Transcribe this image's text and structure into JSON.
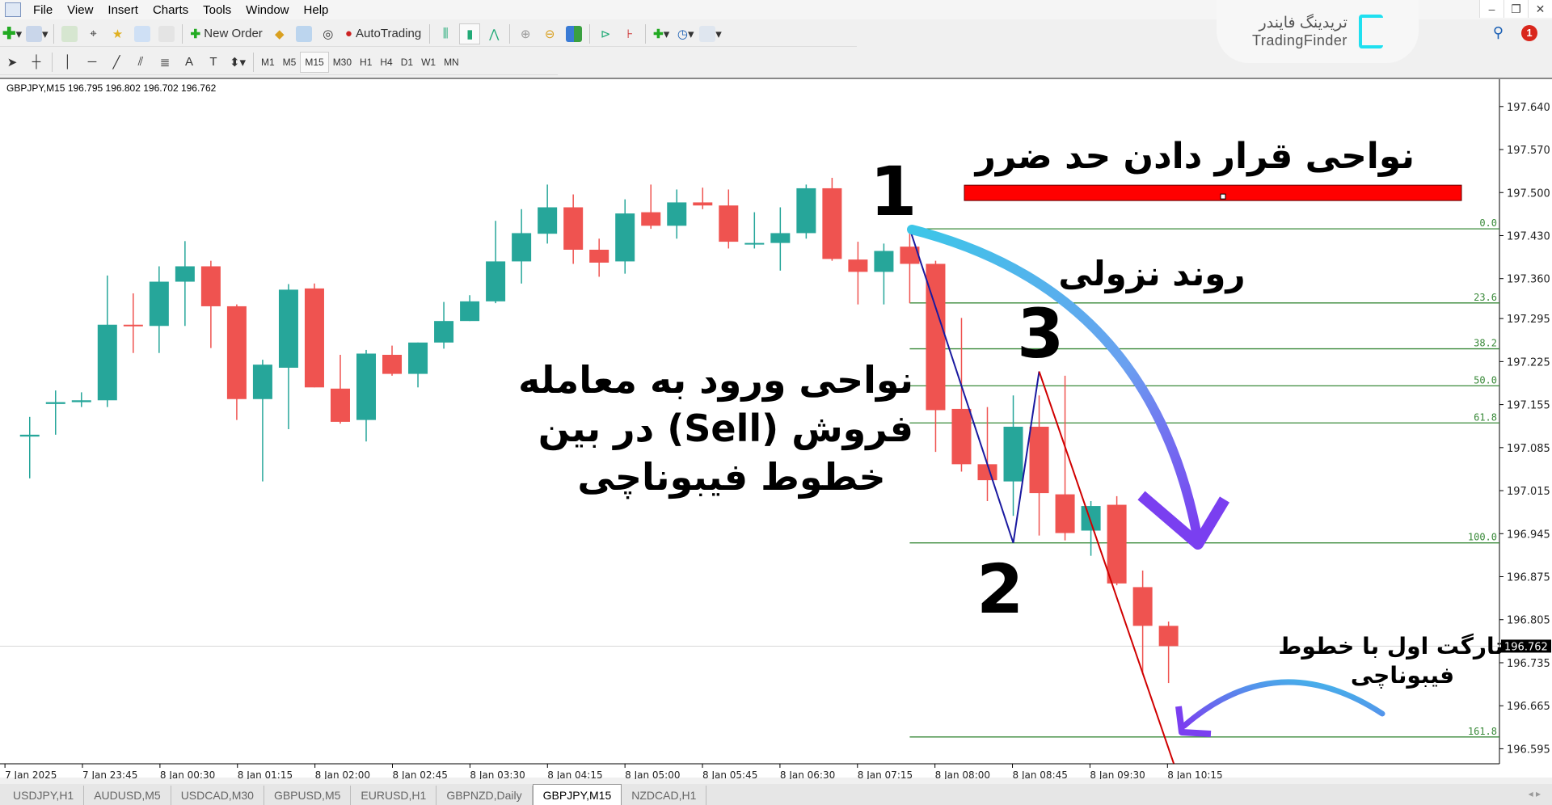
{
  "menu": [
    "File",
    "View",
    "Insert",
    "Charts",
    "Tools",
    "Window",
    "Help"
  ],
  "toolbar": {
    "new_order": "New Order",
    "autotrading": "AutoTrading"
  },
  "timeframes": [
    "M1",
    "M5",
    "M15",
    "M30",
    "H1",
    "H4",
    "D1",
    "W1",
    "MN"
  ],
  "active_timeframe": "M15",
  "logo": {
    "fa": "تریدینگ فایندر",
    "en": "TradingFinder",
    "color": "#1fe0f0"
  },
  "notifications": "1",
  "chart_header": "GBPJPY,M15  196.795 196.802 196.702 196.762",
  "chart_data": {
    "type": "candlestick",
    "symbol": "GBPJPY",
    "timeframe": "M15",
    "colors": {
      "bull": "#26a69a",
      "bear": "#ef5350",
      "fib": "#3a8a3a",
      "zigzag_down": "#1a1aa0",
      "zigzag_up": "#d00000",
      "stop_zone": "#ff0000"
    },
    "y_ticks": [
      "197.640",
      "197.570",
      "197.500",
      "197.430",
      "197.360",
      "197.295",
      "197.225",
      "197.155",
      "197.085",
      "197.015",
      "196.945",
      "196.875",
      "196.805",
      "196.735",
      "196.665",
      "196.595"
    ],
    "current_price": "196.762",
    "x_labels": [
      "7 Jan 2025",
      "7 Jan 23:45",
      "8 Jan 00:30",
      "8 Jan 01:15",
      "8 Jan 02:00",
      "8 Jan 02:45",
      "8 Jan 03:30",
      "8 Jan 04:15",
      "8 Jan 05:00",
      "8 Jan 05:45",
      "8 Jan 06:30",
      "8 Jan 07:15",
      "8 Jan 08:00",
      "8 Jan 08:45",
      "8 Jan 09:30",
      "8 Jan 10:15"
    ],
    "ohlc": [
      [
        197.103,
        197.135,
        197.035,
        197.106
      ],
      [
        197.156,
        197.178,
        197.106,
        197.159
      ],
      [
        197.159,
        197.175,
        197.151,
        197.162
      ],
      [
        197.162,
        197.365,
        197.151,
        197.285
      ],
      [
        197.285,
        197.336,
        197.239,
        197.283
      ],
      [
        197.283,
        197.38,
        197.239,
        197.355
      ],
      [
        197.355,
        197.421,
        197.283,
        197.38
      ],
      [
        197.38,
        197.389,
        197.247,
        197.315
      ],
      [
        197.315,
        197.318,
        197.13,
        197.164
      ],
      [
        197.164,
        197.228,
        197.03,
        197.22
      ],
      [
        197.215,
        197.351,
        197.115,
        197.342
      ],
      [
        197.344,
        197.352,
        197.183,
        197.183
      ],
      [
        197.181,
        197.236,
        197.124,
        197.127
      ],
      [
        197.13,
        197.244,
        197.095,
        197.238
      ],
      [
        197.236,
        197.251,
        197.202,
        197.205
      ],
      [
        197.205,
        197.256,
        197.183,
        197.256
      ],
      [
        197.256,
        197.322,
        197.246,
        197.291
      ],
      [
        197.291,
        197.333,
        197.291,
        197.323
      ],
      [
        197.323,
        197.454,
        197.32,
        197.388
      ],
      [
        197.388,
        197.473,
        197.352,
        197.434
      ],
      [
        197.433,
        197.513,
        197.417,
        197.476
      ],
      [
        197.476,
        197.497,
        197.384,
        197.407
      ],
      [
        197.407,
        197.425,
        197.363,
        197.386
      ],
      [
        197.388,
        197.489,
        197.368,
        197.466
      ],
      [
        197.468,
        197.513,
        197.441,
        197.446
      ],
      [
        197.446,
        197.505,
        197.425,
        197.484
      ],
      [
        197.484,
        197.508,
        197.473,
        197.479
      ],
      [
        197.479,
        197.505,
        197.409,
        197.42
      ],
      [
        197.417,
        197.468,
        197.409,
        197.418
      ],
      [
        197.418,
        197.476,
        197.373,
        197.434
      ],
      [
        197.434,
        197.513,
        197.425,
        197.507
      ],
      [
        197.507,
        197.524,
        197.389,
        197.392
      ],
      [
        197.391,
        197.42,
        197.318,
        197.371
      ],
      [
        197.371,
        197.417,
        197.318,
        197.405
      ],
      [
        197.412,
        197.441,
        197.32,
        197.384
      ],
      [
        197.384,
        197.389,
        197.078,
        197.146
      ],
      [
        197.148,
        197.296,
        197.046,
        197.058
      ],
      [
        197.058,
        197.151,
        196.998,
        197.032
      ],
      [
        197.03,
        197.17,
        196.974,
        197.119
      ],
      [
        197.119,
        197.17,
        196.942,
        197.011
      ],
      [
        197.009,
        197.202,
        196.934,
        196.946
      ],
      [
        196.95,
        196.998,
        196.909,
        196.99
      ],
      [
        196.992,
        197.006,
        196.861,
        196.864
      ],
      [
        196.858,
        196.885,
        196.716,
        196.795
      ],
      [
        196.795,
        196.802,
        196.702,
        196.762
      ]
    ],
    "fibonacci": {
      "high": 197.441,
      "low": 196.93,
      "levels": [
        "0.0",
        "23.6",
        "38.2",
        "50.0",
        "61.8",
        "100.0",
        "161.8"
      ]
    },
    "stop_zone": {
      "top": 197.512,
      "bottom": 197.487
    },
    "zigzag": [
      {
        "bar": 34,
        "price": 197.441
      },
      {
        "bar": 38,
        "price": 196.93
      },
      {
        "bar": 39,
        "price": 197.209
      },
      {
        "bar": 44.2,
        "price": 196.571
      }
    ]
  },
  "annotations": {
    "stop_loss": "نواحی قرار دادن حد ضرر",
    "downtrend": "روند نزولی",
    "entry": [
      "نواحی ورود به معامله",
      "فروش (Sell) در بین",
      "خطوط فیبوناچی"
    ],
    "target": [
      "تارگت اول با خطوط",
      "فیبوناچی"
    ],
    "point1": "1",
    "point2": "2",
    "point3": "3"
  },
  "tabs": [
    "USDJPY,H1",
    "AUDUSD,M5",
    "USDCAD,M30",
    "GBPUSD,M5",
    "EURUSD,H1",
    "GBPNZD,Daily",
    "GBPJPY,M15",
    "NZDCAD,H1"
  ],
  "active_tab": "GBPJPY,M15"
}
